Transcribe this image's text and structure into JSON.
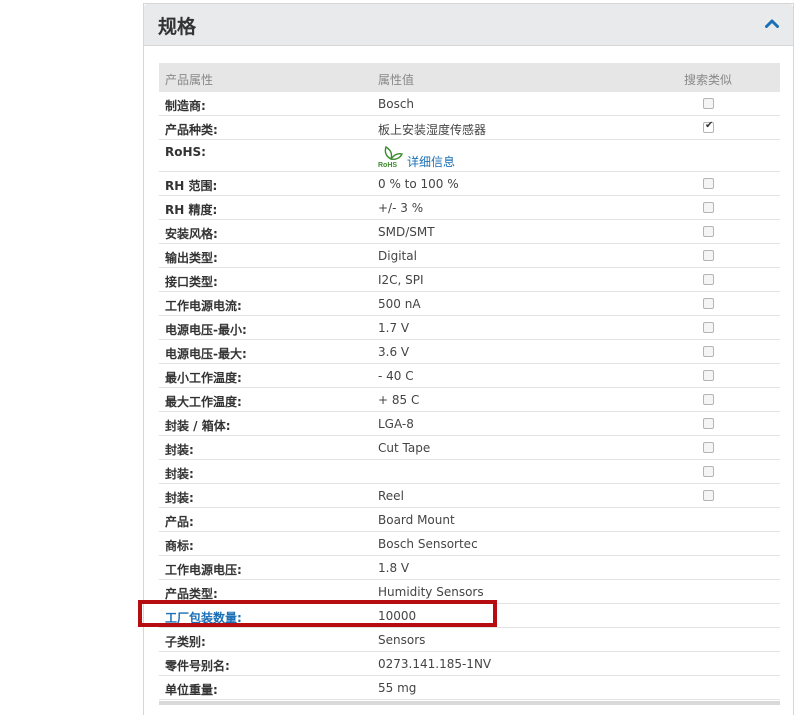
{
  "panel": {
    "title": "规格",
    "collapse_icon": "chevron-up-icon"
  },
  "table": {
    "headers": {
      "attribute": "产品属性",
      "value": "属性值",
      "search_similar": "搜索类似"
    },
    "rows": [
      {
        "attr": "制造商:",
        "value": "Bosch",
        "checkbox": true,
        "checked": false
      },
      {
        "attr": "产品种类:",
        "value": "板上安装湿度传感器",
        "checkbox": true,
        "checked": true
      },
      {
        "attr": "RoHS:",
        "value": "",
        "rohs": true,
        "rohs_link": "详细信息",
        "rohs_logo_text": "RoHS",
        "checkbox": false
      },
      {
        "attr": "RH 范围:",
        "value": "0 % to 100 %",
        "checkbox": true,
        "checked": false
      },
      {
        "attr": "RH 精度:",
        "value": "+/- 3 %",
        "checkbox": true,
        "checked": false
      },
      {
        "attr": "安装风格:",
        "value": "SMD/SMT",
        "checkbox": true,
        "checked": false
      },
      {
        "attr": "输出类型:",
        "value": "Digital",
        "checkbox": true,
        "checked": false
      },
      {
        "attr": "接口类型:",
        "value": "I2C, SPI",
        "checkbox": true,
        "checked": false
      },
      {
        "attr": "工作电源电流:",
        "value": "500 nA",
        "checkbox": true,
        "checked": false
      },
      {
        "attr": "电源电压-最小:",
        "value": "1.7 V",
        "checkbox": true,
        "checked": false
      },
      {
        "attr": "电源电压-最大:",
        "value": "3.6 V",
        "checkbox": true,
        "checked": false
      },
      {
        "attr": "最小工作温度:",
        "value": "- 40 C",
        "checkbox": true,
        "checked": false
      },
      {
        "attr": "最大工作温度:",
        "value": "+ 85 C",
        "checkbox": true,
        "checked": false
      },
      {
        "attr": "封装 / 箱体:",
        "value": "LGA-8",
        "checkbox": true,
        "checked": false
      },
      {
        "attr": "封装:",
        "value": "Cut Tape",
        "checkbox": true,
        "checked": false
      },
      {
        "attr": "封装:",
        "value": "",
        "checkbox": true,
        "checked": false
      },
      {
        "attr": "封装:",
        "value": "Reel",
        "checkbox": true,
        "checked": false
      },
      {
        "attr": "产品:",
        "value": "Board Mount",
        "checkbox": false
      },
      {
        "attr": "商标:",
        "value": "Bosch Sensortec",
        "checkbox": false
      },
      {
        "attr": "工作电源电压:",
        "value": "1.8 V",
        "checkbox": false
      },
      {
        "attr": "产品类型:",
        "value": "Humidity Sensors",
        "checkbox": false
      },
      {
        "attr": "工厂包装数量:",
        "value": "10000",
        "checkbox": false,
        "link": true,
        "highlighted": true
      },
      {
        "attr": "子类别:",
        "value": "Sensors",
        "checkbox": false
      },
      {
        "attr": "零件号别名:",
        "value": "0273.141.185-1NV",
        "checkbox": false
      },
      {
        "attr": "单位重量:",
        "value": "55 mg",
        "checkbox": false
      }
    ]
  },
  "colors": {
    "header_bg": "#e8eaec",
    "link": "#1a6fb5",
    "highlight_border": "#b50d10",
    "rohs_green": "#3c8a2e"
  }
}
